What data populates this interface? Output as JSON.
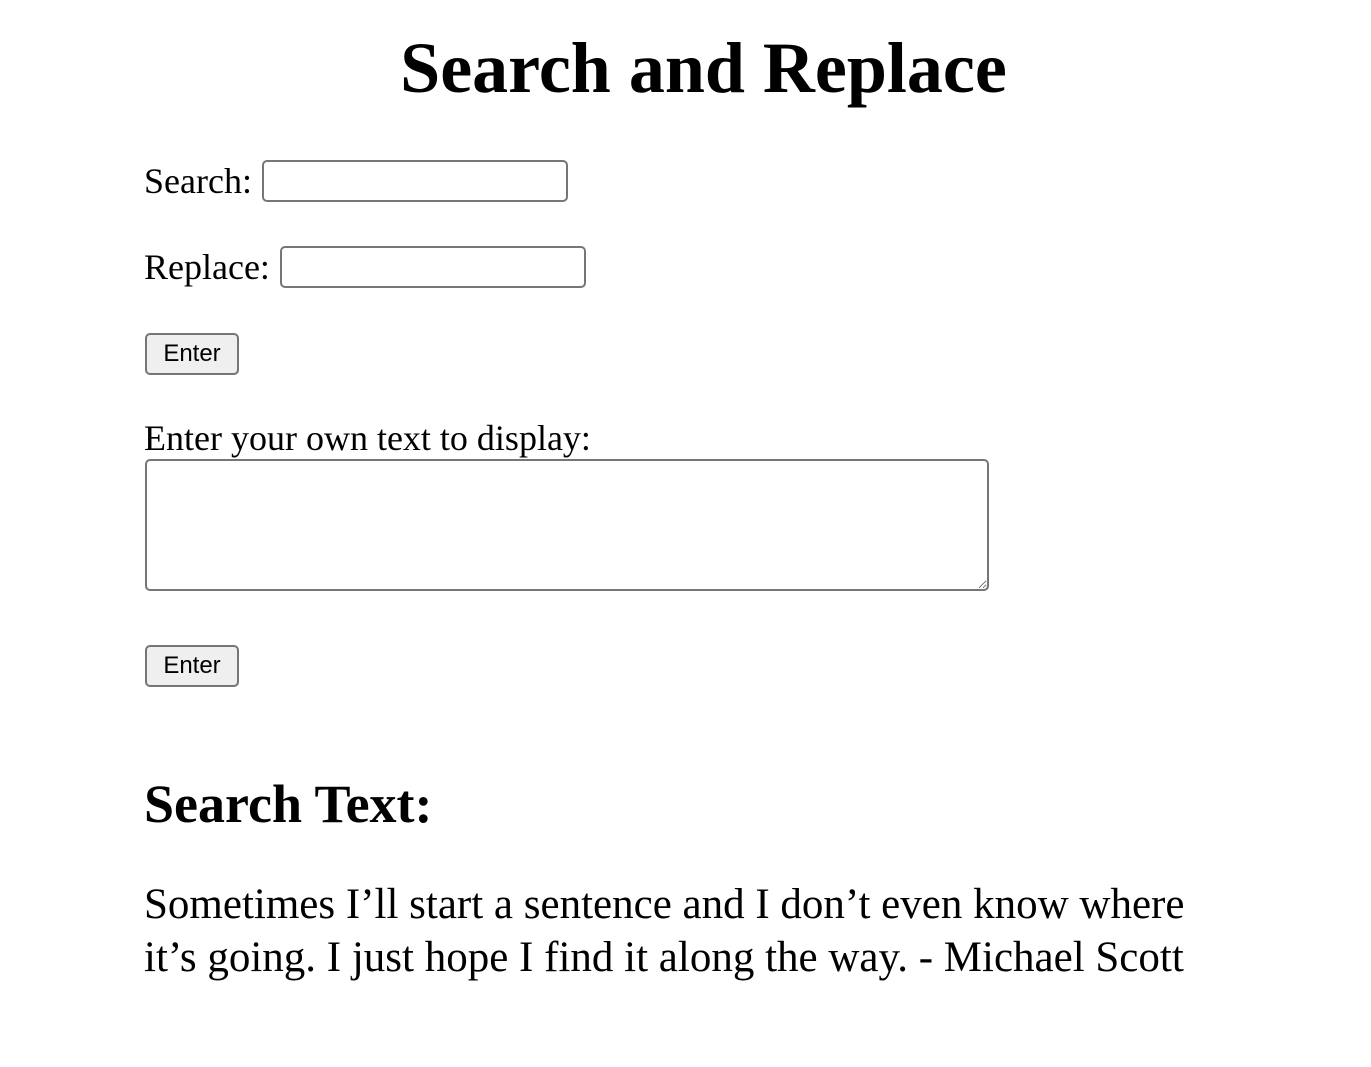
{
  "header": {
    "title": "Search and Replace"
  },
  "search_form": {
    "search_label": "Search:",
    "search_value": "",
    "replace_label": "Replace:",
    "replace_value": "",
    "submit_label": "Enter"
  },
  "custom_text_form": {
    "label": "Enter your own text to display:",
    "textarea_value": "",
    "submit_label": "Enter"
  },
  "output": {
    "heading": "Search Text:",
    "text": "Sometimes I’ll start a sentence and I don’t even know where it’s going. I just hope I find it along the way. - Michael Scott"
  }
}
